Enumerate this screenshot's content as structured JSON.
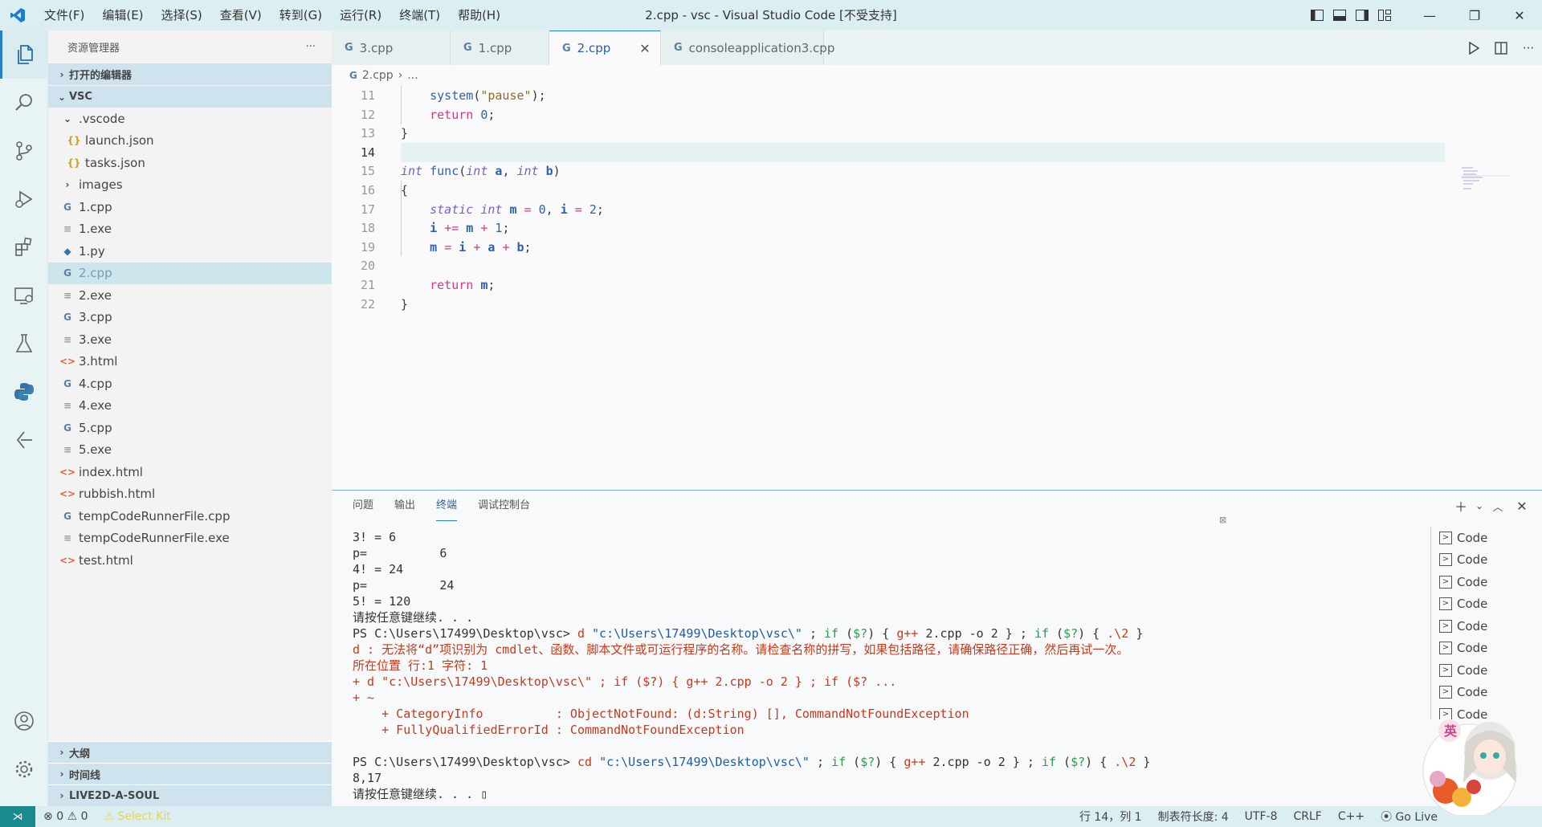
{
  "window": {
    "title": "2.cpp - vsc - Visual Studio Code [不受支持]"
  },
  "menu": [
    "文件(F)",
    "编辑(E)",
    "选择(S)",
    "查看(V)",
    "转到(G)",
    "运行(R)",
    "终端(T)",
    "帮助(H)"
  ],
  "sidebar": {
    "title": "资源管理器",
    "more": "···",
    "open_editors": "打开的编辑器",
    "folder": "VSC",
    "tree": [
      {
        "name": ".vscode",
        "kind": "folder-open",
        "depth": 1
      },
      {
        "name": "launch.json",
        "kind": "json",
        "depth": 2
      },
      {
        "name": "tasks.json",
        "kind": "json",
        "depth": 2
      },
      {
        "name": "images",
        "kind": "folder",
        "depth": 1
      },
      {
        "name": "1.cpp",
        "kind": "cpp",
        "depth": 1
      },
      {
        "name": "1.exe",
        "kind": "exe",
        "depth": 1
      },
      {
        "name": "1.py",
        "kind": "py",
        "depth": 1
      },
      {
        "name": "2.cpp",
        "kind": "cpp",
        "depth": 1,
        "selected": true
      },
      {
        "name": "2.exe",
        "kind": "exe",
        "depth": 1
      },
      {
        "name": "3.cpp",
        "kind": "cpp",
        "depth": 1
      },
      {
        "name": "3.exe",
        "kind": "exe",
        "depth": 1
      },
      {
        "name": "3.html",
        "kind": "html",
        "depth": 1
      },
      {
        "name": "4.cpp",
        "kind": "cpp",
        "depth": 1
      },
      {
        "name": "4.exe",
        "kind": "exe",
        "depth": 1
      },
      {
        "name": "5.cpp",
        "kind": "cpp",
        "depth": 1
      },
      {
        "name": "5.exe",
        "kind": "exe",
        "depth": 1
      },
      {
        "name": "index.html",
        "kind": "html",
        "depth": 1
      },
      {
        "name": "rubbish.html",
        "kind": "html",
        "depth": 1
      },
      {
        "name": "tempCodeRunnerFile.cpp",
        "kind": "cpp",
        "depth": 1
      },
      {
        "name": "tempCodeRunnerFile.exe",
        "kind": "exe",
        "depth": 1
      },
      {
        "name": "test.html",
        "kind": "html",
        "depth": 1
      }
    ],
    "bottom_sections": [
      "大纲",
      "时间线",
      "LIVE2D-A-SOUL"
    ]
  },
  "tabs": [
    {
      "label": "3.cpp",
      "active": false
    },
    {
      "label": "1.cpp",
      "active": false
    },
    {
      "label": "2.cpp",
      "active": true
    },
    {
      "label": "consoleapplication3.cpp",
      "active": false
    }
  ],
  "breadcrumb": {
    "file": "2.cpp",
    "rest": "..."
  },
  "editor": {
    "current_line": 14,
    "lines": [
      {
        "n": "11",
        "html": "    <span class='fn'>system</span>(<span class='st'>\"pause\"</span>);"
      },
      {
        "n": "12",
        "html": "    <span class='kw'>return</span> <span class='nm'>0</span>;"
      },
      {
        "n": "13",
        "html": "}"
      },
      {
        "n": "14",
        "html": ""
      },
      {
        "n": "15",
        "html": "<span class='ty'>int</span> <span class='fn'>func</span>(<span class='ty'>int</span> <span class='vr'>a</span>, <span class='ty'>int</span> <span class='vr'>b</span>)"
      },
      {
        "n": "16",
        "html": "{"
      },
      {
        "n": "17",
        "html": "    <span class='ty'>static</span> <span class='ty'>int</span> <span class='vr'>m</span> <span class='op'>=</span> <span class='nm'>0</span>, <span class='vr'>i</span> <span class='op'>=</span> <span class='nm'>2</span>;"
      },
      {
        "n": "18",
        "html": "    <span class='vr'>i</span> <span class='op'>+=</span> <span class='vr'>m</span> <span class='op'>+</span> <span class='nm'>1</span>;"
      },
      {
        "n": "19",
        "html": "    <span class='vr'>m</span> <span class='op'>=</span> <span class='vr'>i</span> <span class='op'>+</span> <span class='vr'>a</span> <span class='op'>+</span> <span class='vr'>b</span>;"
      },
      {
        "n": "20",
        "html": ""
      },
      {
        "n": "21",
        "html": "    <span class='kw'>return</span> <span class='vr'>m</span>;"
      },
      {
        "n": "22",
        "html": "}"
      }
    ]
  },
  "panel": {
    "tabs": [
      "问题",
      "输出",
      "终端",
      "调试控制台"
    ],
    "active_tab": "终端",
    "terminal": [
      {
        "t": "3! = 6"
      },
      {
        "t": "p=          6"
      },
      {
        "t": "4! = 24"
      },
      {
        "t": "p=          24"
      },
      {
        "t": "5! = 120"
      },
      {
        "t": "请按任意键继续. . ."
      },
      {
        "html": "PS C:\\Users\\17499\\Desktop\\vsc> <span class='t-cmd'>d</span> <span class='t-str'>\"c:\\Users\\17499\\Desktop\\vsc\\\"</span> ; <span class='t-kw'>if</span> (<span class='t-kw'>$?</span>) { <span class='t-cmd'>g++</span> 2.cpp -o 2 } ; <span class='t-kw'>if</span> (<span class='t-kw'>$?</span>) { <span class='t-cmd'>.\\2</span> }"
      },
      {
        "cls": "t-err",
        "t": "d : 无法将“d”项识别为 cmdlet、函数、脚本文件或可运行程序的名称。请检查名称的拼写，如果包括路径，请确保路径正确，然后再试一次。"
      },
      {
        "cls": "t-err",
        "t": "所在位置 行:1 字符: 1"
      },
      {
        "cls": "t-err",
        "t": "+ d \"c:\\Users\\17499\\Desktop\\vsc\\\" ; if ($?) { g++ 2.cpp -o 2 } ; if ($? ..."
      },
      {
        "cls": "t-err",
        "t": "+ ~"
      },
      {
        "cls": "t-err",
        "t": "    + CategoryInfo          : ObjectNotFound: (d:String) [], CommandNotFoundException"
      },
      {
        "cls": "t-err",
        "t": "    + FullyQualifiedErrorId : CommandNotFoundException"
      },
      {
        "t": " "
      },
      {
        "html": "PS C:\\Users\\17499\\Desktop\\vsc> <span class='t-cmd'>cd</span> <span class='t-str'>\"c:\\Users\\17499\\Desktop\\vsc\\\"</span> ; <span class='t-kw'>if</span> (<span class='t-kw'>$?</span>) { <span class='t-cmd'>g++</span> 2.cpp -o 2 } ; <span class='t-kw'>if</span> (<span class='t-kw'>$?</span>) { <span class='t-cmd'>.\\2</span> }"
      },
      {
        "t": "8,17"
      },
      {
        "t": "请按任意键继续. . . ▯"
      }
    ],
    "terminal_list": [
      "Code",
      "Code",
      "Code",
      "Code",
      "Code",
      "Code",
      "Code",
      "Code",
      "Code"
    ]
  },
  "status": {
    "errors": "0",
    "warnings": "0",
    "kit": "Select Kit",
    "position": "行 14，列 1",
    "tab_size": "制表符长度: 4",
    "encoding": "UTF-8",
    "eol": "CRLF",
    "language": "C++",
    "golive": "Go Live"
  },
  "mascot_text": "英"
}
